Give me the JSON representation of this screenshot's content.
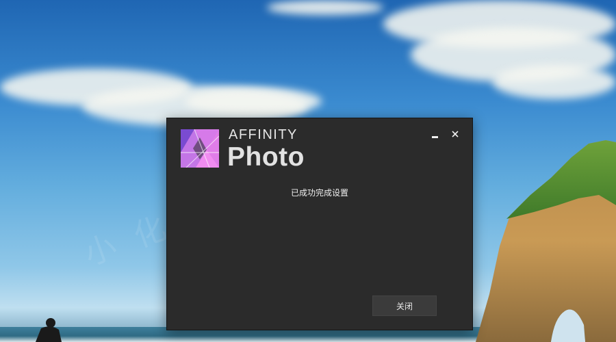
{
  "dialog": {
    "brand_top": "AFFINITY",
    "brand_main": "Photo",
    "message": "已成功完成设置",
    "close_button_label": "关闭",
    "minimize_icon": "minimize-icon",
    "close_icon": "close-icon",
    "logo_icon": "affinity-photo-logo-icon"
  },
  "colors": {
    "dialog_bg": "#2b2b2b",
    "logo_purple_light": "#e37de8",
    "logo_purple_dark": "#7a4bd1",
    "text": "#e2e2e2",
    "button_bg": "#3b3b3b"
  }
}
